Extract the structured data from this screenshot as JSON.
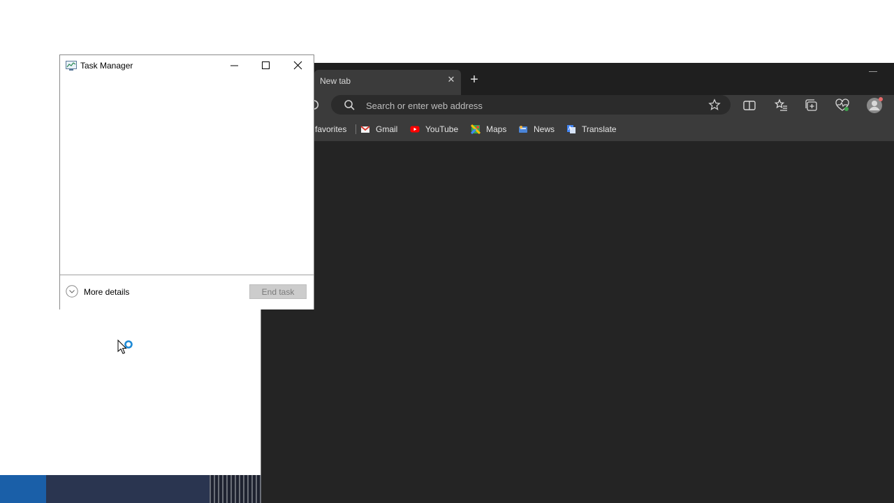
{
  "task_manager": {
    "title": "Task Manager",
    "more_details_label": "More details",
    "end_task_label": "End task"
  },
  "browser": {
    "tab_title": "New tab",
    "address_placeholder": "Search or enter web address",
    "bookmarks": {
      "favorites": "favorites",
      "gmail": "Gmail",
      "youtube": "YouTube",
      "maps": "Maps",
      "news": "News",
      "translate": "Translate"
    }
  },
  "colors": {
    "browser_bg": "#242424",
    "toolbar": "#3b3b3b",
    "busy_cursor_accent": "#1e8ad6"
  }
}
